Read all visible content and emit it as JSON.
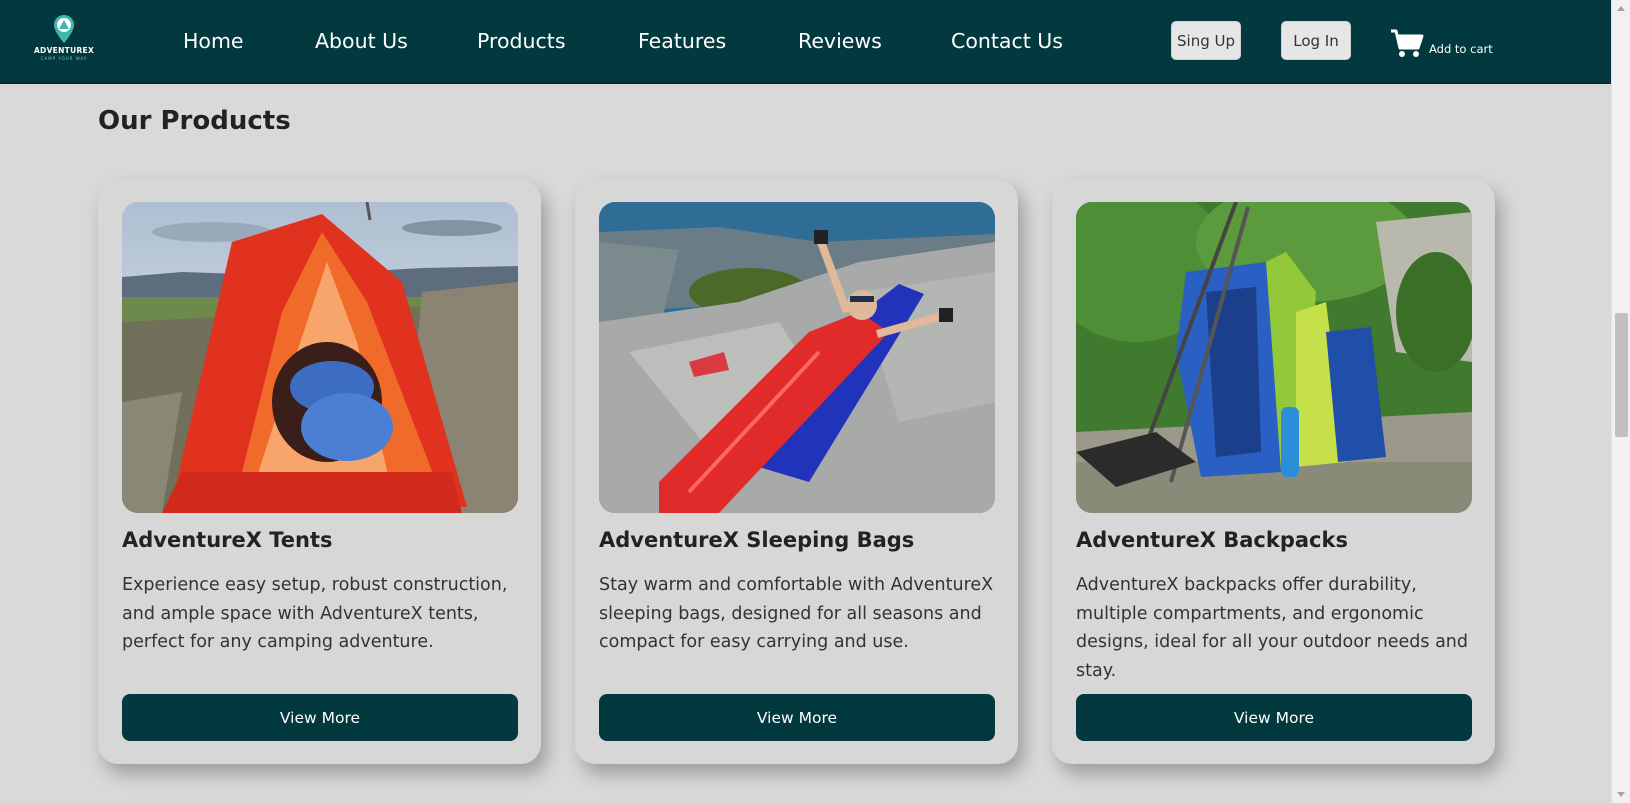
{
  "header": {
    "logo": {
      "name": "ADVENTUREX",
      "tagline": "CAMP YOUR WAY"
    },
    "nav": [
      {
        "label": "Home"
      },
      {
        "label": "About Us"
      },
      {
        "label": "Products"
      },
      {
        "label": "Features"
      },
      {
        "label": "Reviews"
      },
      {
        "label": "Contact Us"
      }
    ],
    "signup_label": "Sing Up",
    "login_label": "Log In",
    "cart_label": "Add to cart",
    "cart_icon": "cart-icon"
  },
  "section": {
    "title": "Our Products"
  },
  "products": [
    {
      "title": "AdventureX Tents",
      "description": "Experience easy setup, robust construction, and ample space with AdventureX tents, perfect for any camping adventure.",
      "button": "View More",
      "image": "tent-photo"
    },
    {
      "title": "AdventureX Sleeping Bags",
      "description": "Stay warm and comfortable with AdventureX sleeping bags, designed for all seasons and compact for easy carrying and use.",
      "button": "View More",
      "image": "sleeping-bag-photo"
    },
    {
      "title": "AdventureX Backpacks",
      "description": "AdventureX backpacks offer durability, multiple compartments, and ergonomic designs, ideal for all your outdoor needs and stay.",
      "button": "View More",
      "image": "backpacks-photo"
    }
  ],
  "colors": {
    "header_bg": "#02393e",
    "page_bg": "#d9d9d9",
    "button_bg": "#02393e"
  }
}
